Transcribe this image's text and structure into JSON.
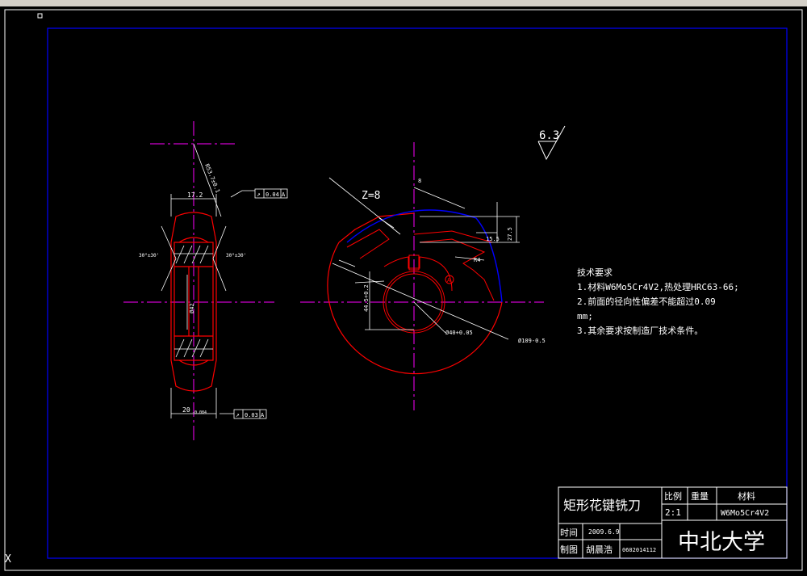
{
  "roughness": {
    "value": "6.3"
  },
  "front_view": {
    "dim_width": "17.2",
    "dim_bottom": "20",
    "dim_bottom_tol": "-0.084",
    "dim_bore_label": "Ø42",
    "dim_radius": "R53.7±0.1",
    "angle_left": "30°±30'",
    "angle_right": "30°±30'",
    "tol_top_symbol": "↗",
    "tol_top_value": "0.04",
    "tol_top_datum": "A",
    "tol_bottom_symbol": "↗",
    "tol_bottom_value": "0.03",
    "tol_bottom_datum": "A"
  },
  "side_view": {
    "teeth": "Z=8",
    "dim_radial": "27.5",
    "dim_step": "15.5",
    "dim_keyway": "44.5+0.2",
    "dim_bore": "Ø40+0.05",
    "dim_outer": "Ø109-0.5",
    "dim_fillet": "R4",
    "dim_small": "8",
    "datum_label": "A"
  },
  "notes": {
    "title": "技术要求",
    "items": [
      "1.材料W6Mo5Cr4V2,热处理HRC63-66;",
      "2.前面的径向性偏差不能超过0.09",
      "mm;",
      "3.其余要求按制造厂技术条件。"
    ]
  },
  "title_block": {
    "part_name": "矩形花键铣刀",
    "scale_label": "比例",
    "weight_label": "重量",
    "material_label": "材料",
    "scale_value": "2:1",
    "material_value": "W6Mo5Cr4V2",
    "date_label": "时间",
    "date_value": "2009.6.9",
    "drawn_label": "制图",
    "drawn_value": "胡晨浩",
    "student_id": "0602014112",
    "school": "中北大学"
  },
  "colors": {
    "border": "#0000ff",
    "part": "#ff0000",
    "center_line": "#ff00ff",
    "dimension": "#ffffff",
    "outline_blue": "#0000ff"
  }
}
